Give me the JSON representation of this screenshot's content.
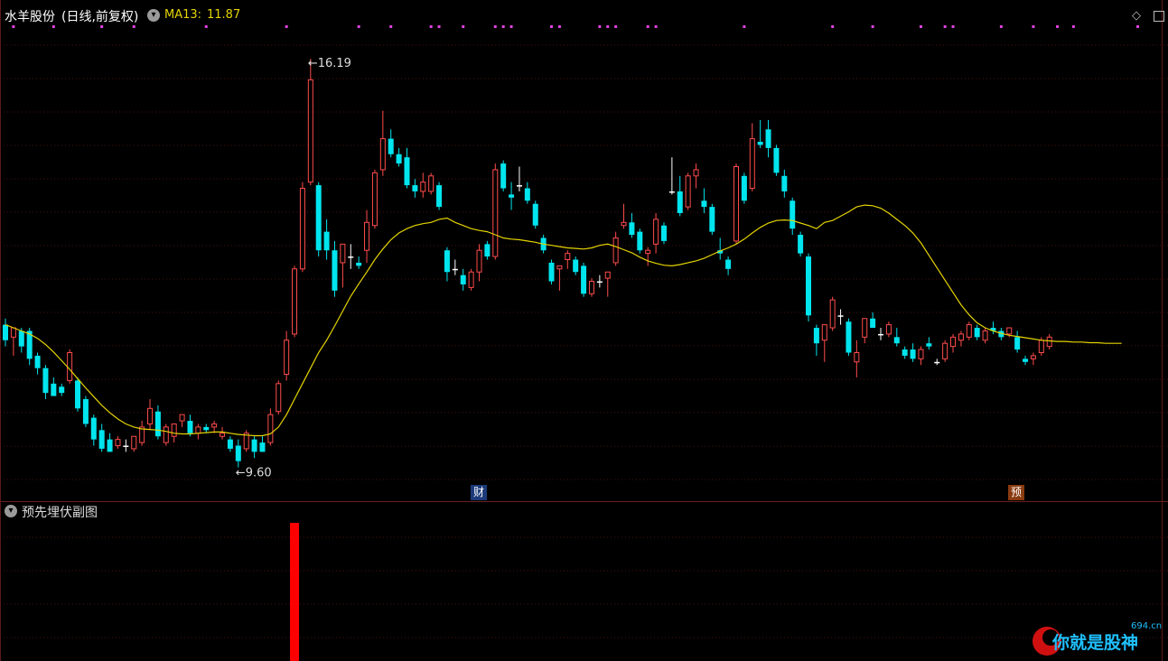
{
  "header": {
    "stock_name": "水羊股份",
    "period_label": "(日线,前复权)",
    "ma_label": "MA13:",
    "ma_value": "11.87"
  },
  "colors": {
    "up": "#ff4c4c",
    "down": "#00e5ee",
    "doji": "#ffffff",
    "ma": "#e5d400",
    "grid": "#4a0f0f",
    "marker": "#e040e0",
    "sub_bar": "#ff0000"
  },
  "annotations": {
    "high_label": "16.19",
    "low_label": "9.60",
    "arrow": "←"
  },
  "event_tags": [
    {
      "label": "财",
      "bg": "#1c3a7a"
    },
    {
      "label": "预",
      "bg": "#8a3a10"
    }
  ],
  "subchart": {
    "title": "预先埋伏副图"
  },
  "watermark": {
    "text": "你就是股神",
    "domain": "694.cn"
  },
  "chart_data": {
    "type": "candlestick",
    "y_range": [
      9.2,
      16.7
    ],
    "ma_period": 13,
    "high_value": 16.19,
    "low_value": 9.6,
    "candles": [
      [
        11.9,
        12.0,
        11.55,
        11.65
      ],
      [
        11.7,
        11.85,
        11.4,
        11.85
      ],
      [
        11.8,
        11.85,
        11.45,
        11.55
      ],
      [
        11.8,
        11.85,
        11.25,
        11.35
      ],
      [
        11.4,
        11.45,
        11.1,
        11.2
      ],
      [
        11.2,
        11.25,
        10.7,
        10.8
      ],
      [
        10.95,
        11.05,
        10.75,
        10.75
      ],
      [
        10.9,
        10.95,
        10.75,
        10.8
      ],
      [
        11.0,
        11.5,
        10.95,
        11.45
      ],
      [
        11.0,
        11.05,
        10.5,
        10.55
      ],
      [
        10.7,
        10.75,
        10.25,
        10.3
      ],
      [
        10.4,
        10.45,
        9.95,
        10.05
      ],
      [
        10.2,
        10.3,
        9.85,
        9.9
      ],
      [
        10.05,
        10.15,
        9.85,
        9.85
      ],
      [
        9.95,
        10.1,
        9.9,
        10.05
      ],
      [
        9.95,
        10.05,
        9.85,
        9.95
      ],
      [
        9.9,
        10.1,
        9.85,
        10.1
      ],
      [
        10.0,
        10.35,
        9.95,
        10.25
      ],
      [
        10.3,
        10.7,
        10.2,
        10.55
      ],
      [
        10.5,
        10.6,
        10.05,
        10.1
      ],
      [
        10.0,
        10.3,
        9.95,
        10.25
      ],
      [
        10.1,
        10.3,
        10.0,
        10.3
      ],
      [
        10.35,
        10.45,
        10.25,
        10.45
      ],
      [
        10.35,
        10.45,
        10.1,
        10.15
      ],
      [
        10.15,
        10.3,
        10.05,
        10.25
      ],
      [
        10.25,
        10.3,
        10.15,
        10.2
      ],
      [
        10.25,
        10.35,
        10.15,
        10.3
      ],
      [
        10.1,
        10.25,
        10.05,
        10.15
      ],
      [
        10.05,
        10.1,
        9.85,
        9.9
      ],
      [
        9.95,
        10.05,
        9.6,
        9.7
      ],
      [
        9.9,
        10.2,
        9.85,
        10.15
      ],
      [
        10.05,
        10.1,
        9.75,
        9.85
      ],
      [
        10.0,
        10.1,
        9.85,
        9.85
      ],
      [
        10.0,
        10.55,
        9.95,
        10.45
      ],
      [
        10.5,
        11.0,
        10.45,
        10.95
      ],
      [
        11.1,
        11.8,
        11.0,
        11.65
      ],
      [
        11.75,
        12.85,
        11.7,
        12.8
      ],
      [
        12.8,
        14.2,
        12.75,
        14.1
      ],
      [
        14.2,
        16.19,
        14.15,
        15.85
      ],
      [
        14.15,
        14.2,
        13.0,
        13.1
      ],
      [
        13.4,
        13.6,
        12.95,
        13.1
      ],
      [
        13.1,
        13.25,
        12.35,
        12.45
      ],
      [
        12.9,
        13.2,
        12.5,
        13.2
      ],
      [
        13.0,
        13.2,
        12.8,
        13.0
      ],
      [
        12.9,
        13.0,
        12.8,
        12.85
      ],
      [
        13.1,
        13.75,
        12.9,
        13.55
      ],
      [
        13.5,
        14.4,
        13.45,
        14.35
      ],
      [
        14.4,
        15.35,
        14.3,
        14.9
      ],
      [
        14.9,
        15.05,
        14.6,
        14.65
      ],
      [
        14.65,
        14.75,
        14.45,
        14.5
      ],
      [
        14.6,
        14.75,
        14.1,
        14.15
      ],
      [
        14.15,
        14.25,
        13.95,
        14.05
      ],
      [
        14.05,
        14.35,
        13.95,
        14.2
      ],
      [
        14.05,
        14.35,
        14.0,
        14.3
      ],
      [
        14.15,
        14.2,
        13.75,
        13.8
      ],
      [
        13.1,
        13.15,
        12.6,
        12.75
      ],
      [
        12.8,
        12.95,
        12.7,
        12.8
      ],
      [
        12.7,
        12.8,
        12.45,
        12.55
      ],
      [
        12.5,
        12.8,
        12.45,
        12.75
      ],
      [
        12.75,
        13.2,
        12.6,
        13.1
      ],
      [
        13.2,
        13.25,
        12.95,
        13.0
      ],
      [
        13.0,
        14.5,
        12.95,
        14.4
      ],
      [
        14.5,
        14.55,
        14.05,
        14.1
      ],
      [
        14.0,
        14.2,
        13.75,
        13.95
      ],
      [
        14.15,
        14.45,
        14.05,
        14.15
      ],
      [
        14.1,
        14.2,
        13.85,
        13.9
      ],
      [
        13.85,
        13.9,
        13.45,
        13.5
      ],
      [
        13.3,
        13.35,
        13.05,
        13.1
      ],
      [
        12.9,
        12.95,
        12.55,
        12.6
      ],
      [
        12.8,
        12.85,
        12.45,
        12.85
      ],
      [
        12.95,
        13.1,
        12.8,
        13.05
      ],
      [
        12.95,
        13.0,
        12.7,
        12.75
      ],
      [
        12.85,
        12.9,
        12.35,
        12.4
      ],
      [
        12.4,
        12.65,
        12.35,
        12.6
      ],
      [
        12.6,
        12.7,
        12.5,
        12.6
      ],
      [
        12.65,
        12.75,
        12.35,
        12.75
      ],
      [
        12.9,
        13.4,
        12.85,
        13.3
      ],
      [
        13.5,
        13.85,
        13.45,
        13.55
      ],
      [
        13.55,
        13.7,
        13.3,
        13.35
      ],
      [
        13.4,
        13.45,
        13.05,
        13.1
      ],
      [
        13.05,
        13.15,
        12.85,
        13.1
      ],
      [
        13.2,
        13.7,
        13.05,
        13.6
      ],
      [
        13.5,
        13.55,
        13.2,
        13.25
      ],
      [
        14.05,
        14.6,
        14.0,
        14.05
      ],
      [
        14.05,
        14.3,
        13.65,
        13.7
      ],
      [
        13.8,
        14.35,
        13.75,
        14.3
      ],
      [
        14.3,
        14.5,
        14.1,
        14.4
      ],
      [
        13.9,
        14.1,
        13.7,
        13.8
      ],
      [
        13.8,
        13.85,
        13.35,
        13.4
      ],
      [
        13.1,
        13.3,
        12.95,
        13.05
      ],
      [
        12.95,
        13.0,
        12.7,
        12.8
      ],
      [
        13.25,
        14.5,
        13.2,
        14.45
      ],
      [
        14.3,
        14.35,
        13.85,
        13.9
      ],
      [
        14.1,
        15.15,
        14.05,
        14.9
      ],
      [
        14.85,
        15.2,
        14.75,
        14.8
      ],
      [
        15.05,
        15.2,
        14.6,
        14.75
      ],
      [
        14.75,
        14.8,
        14.3,
        14.35
      ],
      [
        14.3,
        14.4,
        13.95,
        14.05
      ],
      [
        13.9,
        13.95,
        13.35,
        13.45
      ],
      [
        13.35,
        13.4,
        13.0,
        13.05
      ],
      [
        13.0,
        13.05,
        11.95,
        12.05
      ],
      [
        11.85,
        11.9,
        11.4,
        11.6
      ],
      [
        11.65,
        11.75,
        11.3,
        11.9
      ],
      [
        11.85,
        12.35,
        11.8,
        12.3
      ],
      [
        12.05,
        12.15,
        11.9,
        12.05
      ],
      [
        11.95,
        12.0,
        11.4,
        11.45
      ],
      [
        11.3,
        11.65,
        11.05,
        11.45
      ],
      [
        11.7,
        12.0,
        11.6,
        12.0
      ],
      [
        12.0,
        12.1,
        11.85,
        11.85
      ],
      [
        11.75,
        11.85,
        11.65,
        11.75
      ],
      [
        11.75,
        11.95,
        11.7,
        11.9
      ],
      [
        11.7,
        11.85,
        11.55,
        11.6
      ],
      [
        11.5,
        11.55,
        11.35,
        11.4
      ],
      [
        11.5,
        11.6,
        11.3,
        11.35
      ],
      [
        11.35,
        11.55,
        11.25,
        11.5
      ],
      [
        11.6,
        11.7,
        11.5,
        11.55
      ],
      [
        11.3,
        11.35,
        11.25,
        11.3
      ],
      [
        11.35,
        11.65,
        11.3,
        11.6
      ],
      [
        11.55,
        11.75,
        11.45,
        11.7
      ],
      [
        11.65,
        11.8,
        11.55,
        11.75
      ],
      [
        11.7,
        11.95,
        11.65,
        11.9
      ],
      [
        11.85,
        11.9,
        11.65,
        11.7
      ],
      [
        11.65,
        11.85,
        11.6,
        11.8
      ],
      [
        11.85,
        11.95,
        11.75,
        11.8
      ],
      [
        11.8,
        11.85,
        11.65,
        11.7
      ],
      [
        11.75,
        11.85,
        11.7,
        11.85
      ],
      [
        11.7,
        11.8,
        11.45,
        11.5
      ],
      [
        11.35,
        11.4,
        11.25,
        11.3
      ],
      [
        11.35,
        11.45,
        11.25,
        11.4
      ],
      [
        11.45,
        11.7,
        11.4,
        11.65
      ],
      [
        11.55,
        11.75,
        11.5,
        11.7
      ]
    ],
    "ma13": [
      11.9,
      11.85,
      11.8,
      11.75,
      11.68,
      11.58,
      11.46,
      11.32,
      11.18,
      11.03,
      10.88,
      10.74,
      10.6,
      10.48,
      10.38,
      10.3,
      10.25,
      10.22,
      10.21,
      10.2,
      10.18,
      10.15,
      10.14,
      10.14,
      10.15,
      10.16,
      10.17,
      10.17,
      10.15,
      10.13,
      10.12,
      10.11,
      10.11,
      10.14,
      10.25,
      10.45,
      10.7,
      10.95,
      11.2,
      11.45,
      11.65,
      11.88,
      12.12,
      12.36,
      12.56,
      12.75,
      12.95,
      13.12,
      13.27,
      13.38,
      13.45,
      13.5,
      13.53,
      13.55,
      13.6,
      13.62,
      13.55,
      13.5,
      13.45,
      13.42,
      13.4,
      13.35,
      13.3,
      13.28,
      13.27,
      13.25,
      13.23,
      13.2,
      13.18,
      13.16,
      13.14,
      13.13,
      13.12,
      13.14,
      13.18,
      13.2,
      13.16,
      13.11,
      13.06,
      12.99,
      12.93,
      12.89,
      12.86,
      12.85,
      12.87,
      12.9,
      12.93,
      12.97,
      13.03,
      13.09,
      13.14,
      13.2,
      13.28,
      13.38,
      13.47,
      13.54,
      13.58,
      13.59,
      13.58,
      13.54,
      13.5,
      13.45,
      13.55,
      13.58,
      13.65,
      13.72,
      13.8,
      13.83,
      13.82,
      13.78,
      13.7,
      13.6,
      13.5,
      13.38,
      13.22,
      13.02,
      12.82,
      12.62,
      12.42,
      12.22,
      12.06,
      11.93,
      11.85,
      11.8,
      11.76,
      11.73,
      11.71,
      11.69,
      11.67,
      11.65,
      11.64,
      11.63,
      11.63,
      11.62,
      11.62,
      11.61,
      11.61,
      11.6,
      11.6,
      11.6
    ],
    "sub_bars": [
      {
        "index": 36,
        "value": 1.0
      }
    ],
    "marker_indices": [
      1,
      6,
      12,
      16,
      25,
      35,
      44,
      48,
      53,
      54,
      57,
      61,
      62,
      63,
      68,
      69,
      74,
      75,
      76,
      80,
      81,
      92,
      103,
      108,
      114,
      117,
      118,
      124,
      128,
      131,
      133,
      141,
      146,
      152
    ]
  }
}
